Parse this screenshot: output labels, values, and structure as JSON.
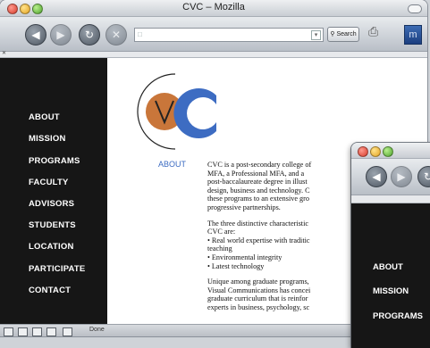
{
  "window": {
    "title": "CVC – Mozilla"
  },
  "toolbar": {
    "back_icon": "back-arrow-icon",
    "forward_icon": "forward-arrow-icon",
    "reload_icon": "reload-icon",
    "stop_icon": "stop-icon",
    "url_value": "",
    "search_label": "Search",
    "print_icon": "print-icon"
  },
  "nav": {
    "items": [
      "ABOUT",
      "MISSION",
      "PROGRAMS",
      "FACULTY",
      "ADVISORS",
      "STUDENTS",
      "LOCATION",
      "PARTICIPATE",
      "CONTACT"
    ]
  },
  "page": {
    "section_label": "ABOUT",
    "para1": [
      "CVC is a post-secondary college of",
      "MFA, a Professional MFA, and a",
      "post-baccalaureate degree in illust",
      "design, business and technology. C",
      "these programs to an extensive gro",
      "progressive partnerships."
    ],
    "para2": [
      "The three distinctive characteristic",
      "CVC are:",
      "• Real world expertise with traditic",
      "teaching",
      "• Environmental integrity",
      "• Latest technology"
    ],
    "para3": [
      "Unique among graduate programs,",
      "Visual Communications has concei",
      "graduate curriculum that is reinfor",
      "experts in business, psychology, sc"
    ]
  },
  "status": {
    "text": "Done"
  },
  "second_window": {
    "nav_items": [
      "ABOUT",
      "MISSION",
      "PROGRAMS"
    ]
  },
  "colors": {
    "accent_blue": "#3d6cc2",
    "logo_orange": "#c9763a",
    "nav_bg": "#161616"
  }
}
